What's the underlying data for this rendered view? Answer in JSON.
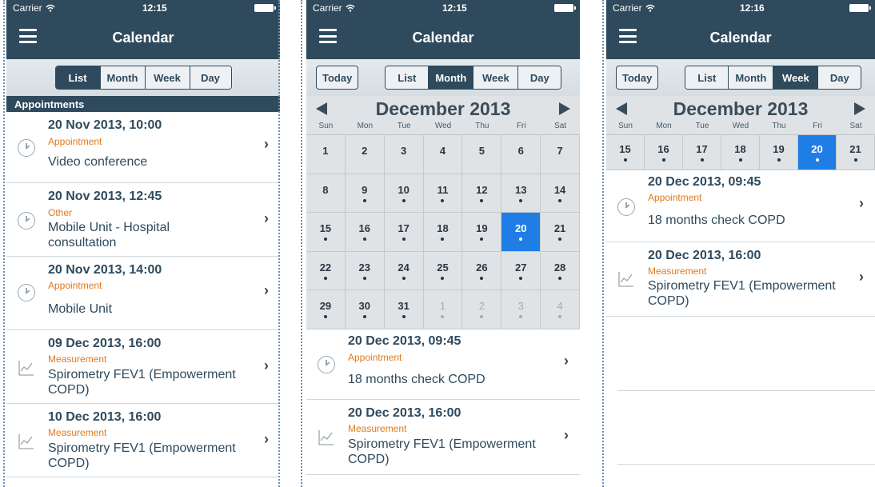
{
  "status_bar": {
    "carrier": "Carrier",
    "battery": "full"
  },
  "nav": {
    "title": "Calendar",
    "menu_icon": "hamburger-menu-icon"
  },
  "segments": {
    "today": "Today",
    "list": "List",
    "month": "Month",
    "week": "Week",
    "day": "Day"
  },
  "colors": {
    "navy": "#2e4a5c",
    "accent": "#e07a1c",
    "selected": "#1e7ee6"
  },
  "screens": [
    {
      "time": "12:15",
      "active_view": "List",
      "section_header": "Appointments",
      "rows": [
        {
          "datetime": "20 Nov 2013, 10:00",
          "category": "Appointment",
          "description": "Video conference",
          "icon": "clock-icon"
        },
        {
          "datetime": "20 Nov 2013, 12:45",
          "category": "Other",
          "description": "Mobile Unit - Hospital consultation",
          "icon": "clock-icon"
        },
        {
          "datetime": "20 Nov 2013, 14:00",
          "category": "Appointment",
          "description": "Mobile Unit",
          "icon": "clock-icon"
        },
        {
          "datetime": "09 Dec 2013, 16:00",
          "category": "Measurement",
          "description": "Spirometry FEV1 (Empowerment COPD)",
          "icon": "chart-icon"
        },
        {
          "datetime": "10 Dec 2013, 16:00",
          "category": "Measurement",
          "description": "Spirometry FEV1 (Empowerment COPD)",
          "icon": "chart-icon"
        }
      ]
    },
    {
      "time": "12:15",
      "active_view": "Month",
      "calendar": {
        "month_label": "December 2013",
        "weekdays": [
          "Sun",
          "Mon",
          "Tue",
          "Wed",
          "Thu",
          "Fri",
          "Sat"
        ],
        "selected_day": "20",
        "days": [
          {
            "d": "1",
            "dot": false,
            "other": false
          },
          {
            "d": "2",
            "dot": false,
            "other": false
          },
          {
            "d": "3",
            "dot": false,
            "other": false
          },
          {
            "d": "4",
            "dot": false,
            "other": false
          },
          {
            "d": "5",
            "dot": false,
            "other": false
          },
          {
            "d": "6",
            "dot": false,
            "other": false
          },
          {
            "d": "7",
            "dot": false,
            "other": false
          },
          {
            "d": "8",
            "dot": false,
            "other": false
          },
          {
            "d": "9",
            "dot": true,
            "other": false
          },
          {
            "d": "10",
            "dot": true,
            "other": false
          },
          {
            "d": "11",
            "dot": true,
            "other": false
          },
          {
            "d": "12",
            "dot": true,
            "other": false
          },
          {
            "d": "13",
            "dot": true,
            "other": false
          },
          {
            "d": "14",
            "dot": true,
            "other": false
          },
          {
            "d": "15",
            "dot": true,
            "other": false
          },
          {
            "d": "16",
            "dot": true,
            "other": false
          },
          {
            "d": "17",
            "dot": true,
            "other": false
          },
          {
            "d": "18",
            "dot": true,
            "other": false
          },
          {
            "d": "19",
            "dot": true,
            "other": false
          },
          {
            "d": "20",
            "dot": true,
            "other": false
          },
          {
            "d": "21",
            "dot": true,
            "other": false
          },
          {
            "d": "22",
            "dot": true,
            "other": false
          },
          {
            "d": "23",
            "dot": true,
            "other": false
          },
          {
            "d": "24",
            "dot": true,
            "other": false
          },
          {
            "d": "25",
            "dot": true,
            "other": false
          },
          {
            "d": "26",
            "dot": true,
            "other": false
          },
          {
            "d": "27",
            "dot": true,
            "other": false
          },
          {
            "d": "28",
            "dot": true,
            "other": false
          },
          {
            "d": "29",
            "dot": true,
            "other": false
          },
          {
            "d": "30",
            "dot": true,
            "other": false
          },
          {
            "d": "31",
            "dot": true,
            "other": false
          },
          {
            "d": "1",
            "dot": true,
            "other": true
          },
          {
            "d": "2",
            "dot": true,
            "other": true
          },
          {
            "d": "3",
            "dot": true,
            "other": true
          },
          {
            "d": "4",
            "dot": true,
            "other": true
          }
        ]
      },
      "rows": [
        {
          "datetime": "20 Dec 2013, 09:45",
          "category": "Appointment",
          "description": "18 months check COPD",
          "icon": "clock-icon"
        },
        {
          "datetime": "20 Dec 2013, 16:00",
          "category": "Measurement",
          "description": "Spirometry FEV1 (Empowerment COPD)",
          "icon": "chart-icon"
        }
      ]
    },
    {
      "time": "12:16",
      "active_view": "Week",
      "calendar": {
        "month_label": "December 2013",
        "weekdays": [
          "Sun",
          "Mon",
          "Tue",
          "Wed",
          "Thu",
          "Fri",
          "Sat"
        ],
        "selected_day": "20",
        "days": [
          {
            "d": "15",
            "dot": true,
            "other": false
          },
          {
            "d": "16",
            "dot": true,
            "other": false
          },
          {
            "d": "17",
            "dot": true,
            "other": false
          },
          {
            "d": "18",
            "dot": true,
            "other": false
          },
          {
            "d": "19",
            "dot": true,
            "other": false
          },
          {
            "d": "20",
            "dot": true,
            "other": false
          },
          {
            "d": "21",
            "dot": true,
            "other": false
          }
        ]
      },
      "rows": [
        {
          "datetime": "20 Dec 2013, 09:45",
          "category": "Appointment",
          "description": "18 months check COPD",
          "icon": "clock-icon"
        },
        {
          "datetime": "20 Dec 2013, 16:00",
          "category": "Measurement",
          "description": "Spirometry FEV1 (Empowerment COPD)",
          "icon": "chart-icon"
        }
      ]
    }
  ]
}
